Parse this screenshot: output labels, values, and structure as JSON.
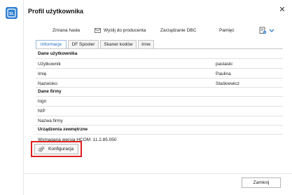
{
  "window": {
    "title": "Profil użytkownika",
    "close_glyph": "✕"
  },
  "app": {
    "icon": "sl-app-icon",
    "icon_text": "SL",
    "accent": "#2f7fd0"
  },
  "toolbar": {
    "items": [
      {
        "label": "Zmiana hasła"
      },
      {
        "label": "Wyślij do producenta",
        "icon": "envelope-icon"
      },
      {
        "label": "Zarządzanie DBC"
      },
      {
        "label": "Pamięć"
      }
    ],
    "right_icons": [
      "settings-document-icon",
      "chevron-down-icon"
    ]
  },
  "tabs": [
    {
      "label": "Informacje",
      "active": true
    },
    {
      "label": "DF Spooler",
      "active": false
    },
    {
      "label": "Skaner kodów",
      "active": false
    },
    {
      "label": "Inne",
      "active": false
    }
  ],
  "sections": {
    "user": {
      "header": "Dane użytkownika",
      "rows": [
        {
          "label": "Użytkownik",
          "value": "pastaski"
        },
        {
          "label": "Imię",
          "value": "Paulina"
        },
        {
          "label": "Nazwisko",
          "value": "Staśkiewicz"
        }
      ]
    },
    "company": {
      "header": "Dane firmy",
      "rows": [
        {
          "label": "logo",
          "value": ""
        },
        {
          "label": "NIP",
          "value": ""
        },
        {
          "label": "Nazwa firmy",
          "value": ""
        }
      ]
    },
    "devices": {
      "header": "Urządzenia zewnętrzne",
      "version_text": "Wymagana wersja HCOM: 11.2.85.050",
      "config_button": {
        "label": "Konfiguracja",
        "icon": "gears-icon"
      },
      "highlight_color": "#e01e1e"
    }
  },
  "footer": {
    "close_label": "Zamknij"
  }
}
